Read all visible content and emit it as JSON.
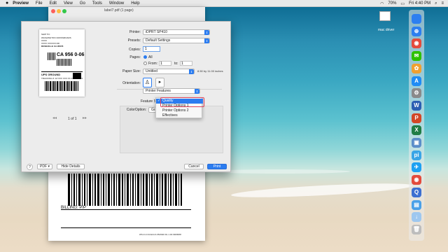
{
  "menubar": {
    "app": "Preview",
    "items": [
      "File",
      "Edit",
      "View",
      "Go",
      "Tools",
      "Window",
      "Help"
    ],
    "clock": "Fri 4:40 PM",
    "battery": "70%"
  },
  "doc_window": {
    "title": "label7.pdf (1 page)",
    "billing": "BILLING: P/P",
    "footer": "WS 21.0.34 ECLS 05/2020 DL 1.00 09/08/08"
  },
  "preview": {
    "ship_to": "SHIP TO:",
    "address": [
      "WASHINGTON CROSSROADS",
      "XXXX",
      "XXXX XXXXXX RD",
      "ROSEVILLE CA 95678"
    ],
    "zip_label": "CA 956 0-06",
    "service": "UPS GROUND",
    "tracking": "TRACKING #: 1Z XXX XXX XX XXXX XXXX",
    "page_indicator": "1 of 1"
  },
  "dialog": {
    "printer_label": "Printer:",
    "printer_value": "iDPRT SP410",
    "presets_label": "Presets:",
    "presets_value": "Default Settings",
    "copies_label": "Copies:",
    "copies_value": "1",
    "pages_label": "Pages:",
    "pages_all": "All",
    "pages_from": "From:",
    "pages_from_value": "1",
    "pages_to": "to:",
    "pages_to_value": "1",
    "paper_label": "Paper Size:",
    "paper_value": "Untitled",
    "paper_dims": "8.50 by 11.00 inches",
    "orientation_label": "Orientation:",
    "section_value": "Printer Features",
    "feature_sets_label": "Feature Sets:",
    "color_option_label": "ColorOption:",
    "color_option_value": "Gra",
    "help": "?",
    "pdf": "PDF",
    "hide_details": "Hide Details",
    "cancel": "Cancel",
    "print": "Print"
  },
  "feature_menu": {
    "items": [
      {
        "label": "Quality",
        "checked": true
      },
      {
        "label": "Printer Options 1",
        "checked": false
      },
      {
        "label": "Printer Options 2",
        "checked": false
      },
      {
        "label": "Effectives",
        "checked": false
      }
    ]
  },
  "desktop": {
    "icon_label": "mac driver"
  },
  "dock": {
    "apps": [
      {
        "name": "finder",
        "color": "#2d7ff0",
        "glyph": ""
      },
      {
        "name": "safari",
        "color": "#2d7ff0",
        "glyph": "⊕"
      },
      {
        "name": "chrome",
        "color": "#e44b3c",
        "glyph": "◉"
      },
      {
        "name": "wechat",
        "color": "#2dc100",
        "glyph": "✉"
      },
      {
        "name": "photos",
        "color": "#f0a030",
        "glyph": "✿"
      },
      {
        "name": "app-store",
        "color": "#1f8cf5",
        "glyph": "A"
      },
      {
        "name": "settings",
        "color": "#8a8a8a",
        "glyph": "⚙"
      },
      {
        "name": "word",
        "color": "#2b5eb2",
        "glyph": "W"
      },
      {
        "name": "powerpoint",
        "color": "#d24726",
        "glyph": "P"
      },
      {
        "name": "excel",
        "color": "#1f7d45",
        "glyph": "X"
      },
      {
        "name": "preview",
        "color": "#5b8ec9",
        "glyph": "▣"
      },
      {
        "name": "ping",
        "color": "#3aa5e6",
        "glyph": "pi"
      },
      {
        "name": "bird-app",
        "color": "#1da1f2",
        "glyph": "✈"
      },
      {
        "name": "chrome-alt",
        "color": "#e44b3c",
        "glyph": "◉"
      },
      {
        "name": "quicktime",
        "color": "#3c6fd1",
        "glyph": "Q"
      },
      {
        "name": "folder",
        "color": "#4aa0e8",
        "glyph": "▤"
      },
      {
        "name": "downloads",
        "color": "#9ec7ef",
        "glyph": "↓"
      },
      {
        "name": "trash",
        "color": "#bdbdbd",
        "glyph": "🗑"
      }
    ]
  }
}
